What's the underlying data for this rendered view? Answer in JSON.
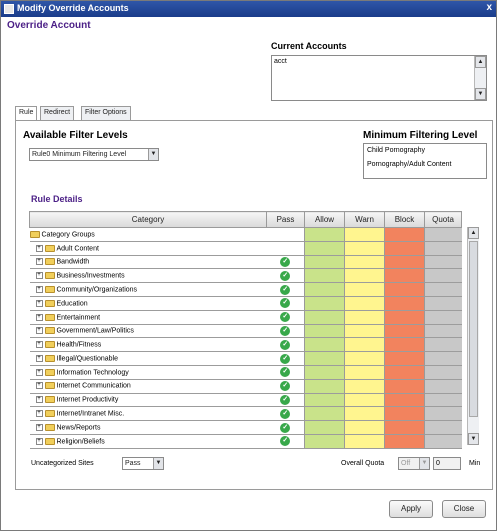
{
  "window": {
    "title": "Modify Override Accounts",
    "close_glyph": "x"
  },
  "header": {
    "section_title": "Override Account"
  },
  "current_accounts": {
    "label": "Current Accounts",
    "items": [
      "acct"
    ]
  },
  "tabs": [
    {
      "label": "Rule",
      "active": true
    },
    {
      "label": "Redirect",
      "active": false
    },
    {
      "label": "Filter Options",
      "active": false
    }
  ],
  "filter": {
    "available_label": "Available Filter Levels",
    "selected_level": "Rule0 Minimum Filtering Level",
    "minimum_label": "Minimum Filtering Level",
    "minimum_items": [
      "Child Pornography",
      "Pornography/Adult Content"
    ]
  },
  "rule_details": {
    "title": "Rule Details",
    "columns": [
      "Category",
      "Pass",
      "Allow",
      "Warn",
      "Block",
      "Quota"
    ],
    "root_label": "Category Groups",
    "rows": [
      {
        "label": "Adult Content",
        "pass": false
      },
      {
        "label": "Bandwidth",
        "pass": true
      },
      {
        "label": "Business/Investments",
        "pass": true
      },
      {
        "label": "Community/Organizations",
        "pass": true
      },
      {
        "label": "Education",
        "pass": true
      },
      {
        "label": "Entertainment",
        "pass": true
      },
      {
        "label": "Government/Law/Politics",
        "pass": true
      },
      {
        "label": "Health/Fitness",
        "pass": true
      },
      {
        "label": "Illegal/Questionable",
        "pass": true
      },
      {
        "label": "Information Technology",
        "pass": true
      },
      {
        "label": "Internet Communication",
        "pass": true
      },
      {
        "label": "Internet Productivity",
        "pass": true
      },
      {
        "label": "Internet/Intranet Misc.",
        "pass": true
      },
      {
        "label": "News/Reports",
        "pass": true
      },
      {
        "label": "Religion/Beliefs",
        "pass": true
      }
    ]
  },
  "footer": {
    "uncategorized_label": "Uncategorized Sites",
    "uncategorized_value": "Pass",
    "overall_quota_label": "Overall Quota",
    "overall_quota_value": "Off",
    "quota_minutes": "0",
    "minutes_unit": "Min"
  },
  "buttons": {
    "apply": "Apply",
    "close": "Close"
  },
  "icons": {
    "check": "check-circle-icon",
    "folder": "folder-icon",
    "expander": "plus-box-icon"
  },
  "colors": {
    "allow": "#c9e38a",
    "warn": "#fff58f",
    "block": "#f2835e",
    "quota": "#c8c8c8",
    "heading": "#4b1f86"
  }
}
